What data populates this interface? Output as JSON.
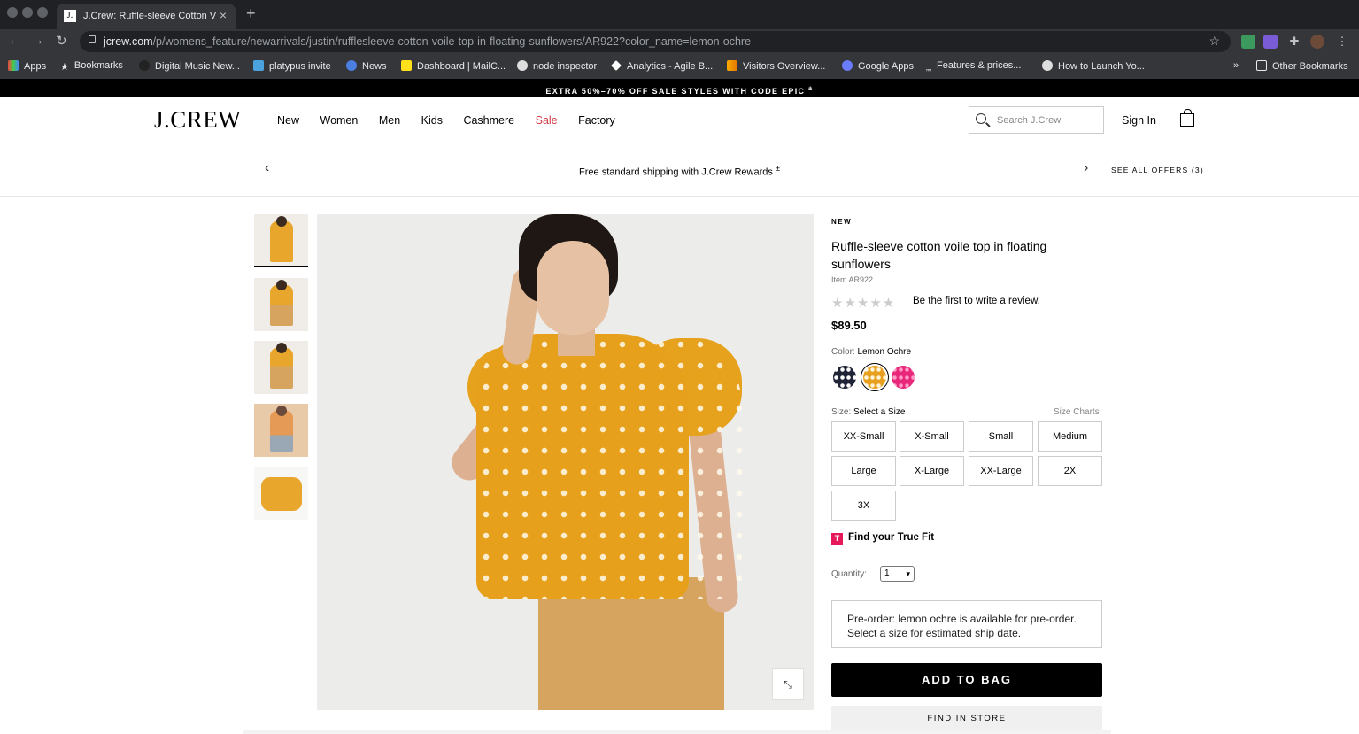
{
  "browser": {
    "tab_title": "J.Crew: Ruffle-sleeve Cotton V",
    "tab_favicon": "J.",
    "url_host": "jcrew.com",
    "url_path": "/p/womens_feature/newarrivals/justin/rufflesleeve-cotton-voile-top-in-floating-sunflowers/AR922?color_name=lemon-ochre",
    "bookmarks": [
      "Apps",
      "Bookmarks",
      "Digital Music New...",
      "platypus invite",
      "News",
      "Dashboard | MailC...",
      "node inspector",
      "Analytics - Agile B...",
      "Visitors Overview...",
      "Google Apps",
      "Features & prices...",
      "How to Launch Yo..."
    ],
    "more_bookmarks": "»",
    "other_bookmarks": "Other Bookmarks"
  },
  "promo": "EXTRA 50%–70% OFF SALE STYLES WITH CODE EPIC",
  "header": {
    "logo": "J.CREW",
    "nav": [
      "New",
      "Women",
      "Men",
      "Kids",
      "Cashmere",
      "Sale",
      "Factory"
    ],
    "search_placeholder": "Search J.Crew",
    "sign_in": "Sign In"
  },
  "shipping": {
    "message": "Free standard shipping with J.Crew Rewards",
    "see_offers": "SEE ALL OFFERS (3)"
  },
  "product": {
    "tag": "NEW",
    "title": "Ruffle-sleeve cotton voile top in floating sunflowers",
    "item": "Item AR922",
    "review_link": "Be the first to write a review.",
    "rating_stars": "★★★★★",
    "price": "$89.50",
    "color_label": "Color:",
    "color_value": "Lemon Ochre",
    "swatch_colors": [
      "#1f2436",
      "#e8a020",
      "#e8287a"
    ],
    "size_label": "Size:",
    "size_value": "Select a Size",
    "size_charts": "Size Charts",
    "sizes": [
      "XX-Small",
      "X-Small",
      "Small",
      "Medium",
      "Large",
      "X-Large",
      "XX-Large",
      "2X",
      "3X"
    ],
    "true_fit": "Find your True Fit",
    "quantity_label": "Quantity:",
    "quantity_value": "1",
    "preorder_note": "Pre-order: lemon ochre is available for pre-order. Select a size for estimated ship date.",
    "add_to_bag": "ADD TO BAG",
    "find_in_store": "FIND IN STORE"
  }
}
